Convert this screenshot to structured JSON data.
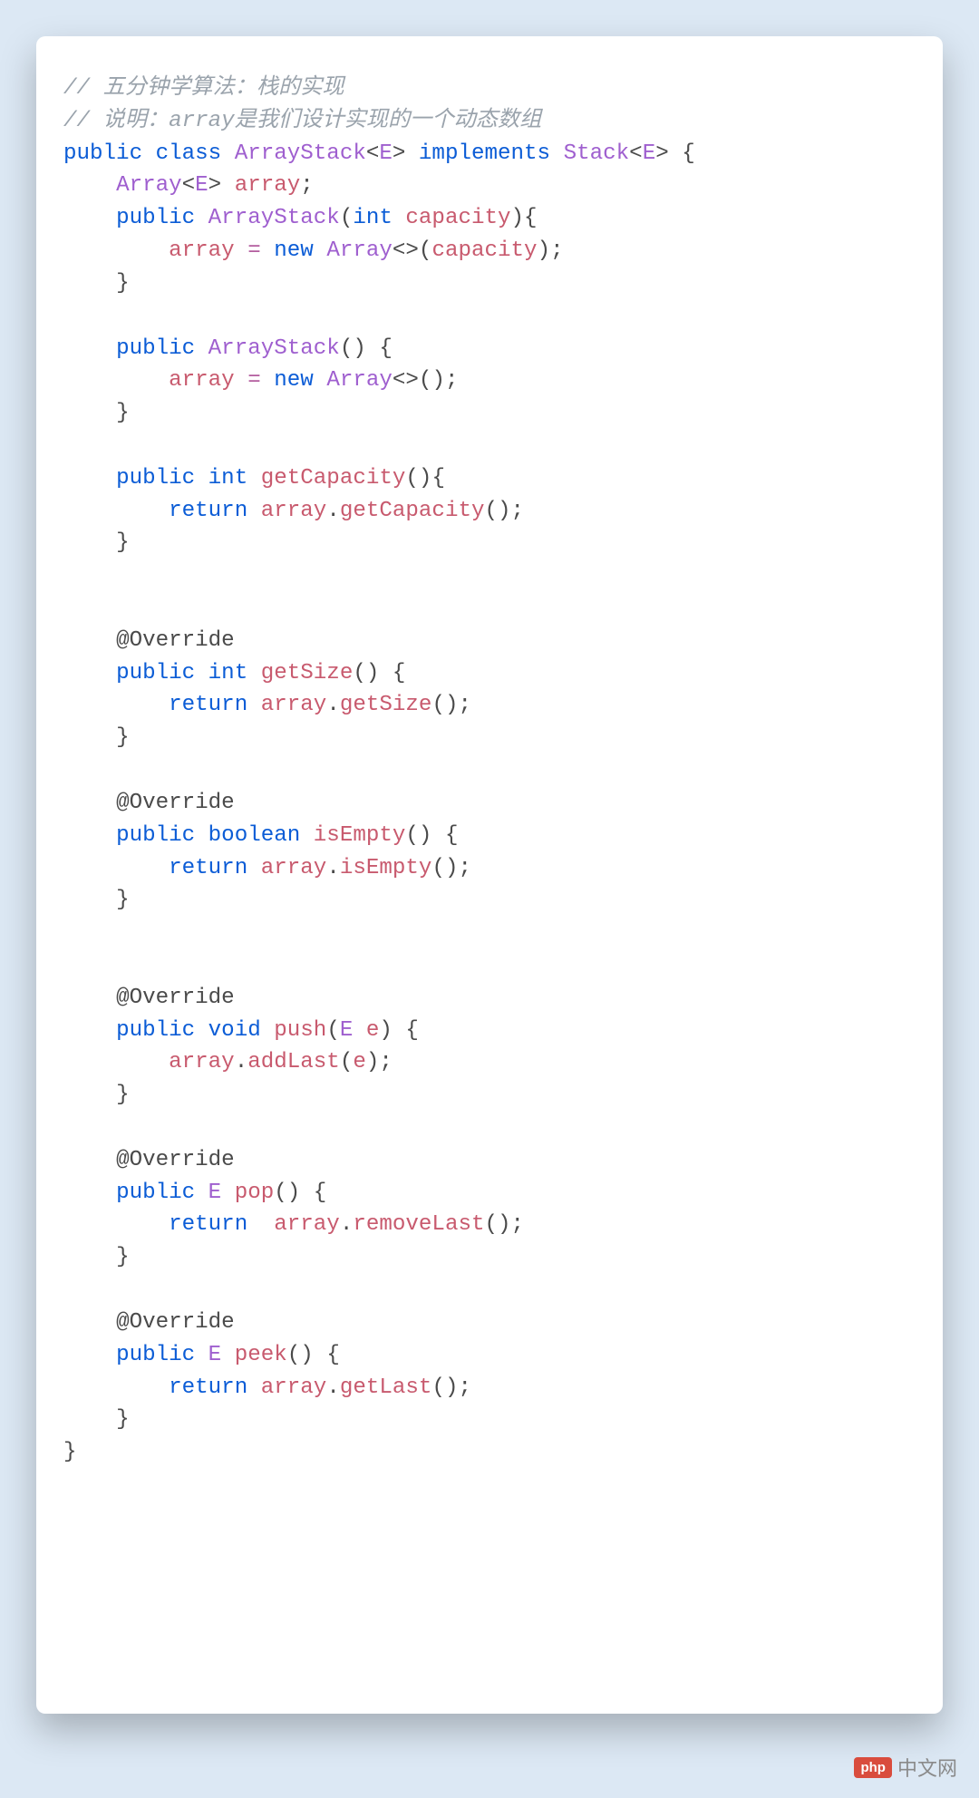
{
  "code": {
    "comment1": "// 五分钟学算法：栈的实现",
    "comment2": "// 说明：array是我们设计实现的一个动态数组",
    "kw_public": "public",
    "kw_class": "class",
    "cls_ArrayStack": "ArrayStack",
    "lt": "<",
    "gt": ">",
    "E": "E",
    "kw_implements": "implements",
    "cls_Stack": "Stack",
    "lbrace": "{",
    "rbrace": "}",
    "cls_Array": "Array",
    "field_array": "array",
    "semi": ";",
    "lparen": "(",
    "rparen": ")",
    "kw_int": "int",
    "p_capacity": "capacity",
    "eq": "=",
    "kw_new": "new",
    "diamond": "<>",
    "ctor_ArrayStack": "ArrayStack",
    "m_getCapacity": "getCapacity",
    "kw_return": "return",
    "dot": ".",
    "ann_Override": "@Override",
    "m_getSize": "getSize",
    "kw_boolean": "boolean",
    "m_isEmpty": "isEmpty",
    "kw_void": "void",
    "m_push": "push",
    "p_e": "e",
    "m_addLast": "addLast",
    "m_pop": "pop",
    "m_removeLast": "removeLast",
    "m_peek": "peek",
    "m_getLast": "getLast",
    "sp1": " ",
    "sp4": "    ",
    "sp8": "        "
  },
  "watermark": {
    "logo": "php",
    "text": "中文网"
  }
}
